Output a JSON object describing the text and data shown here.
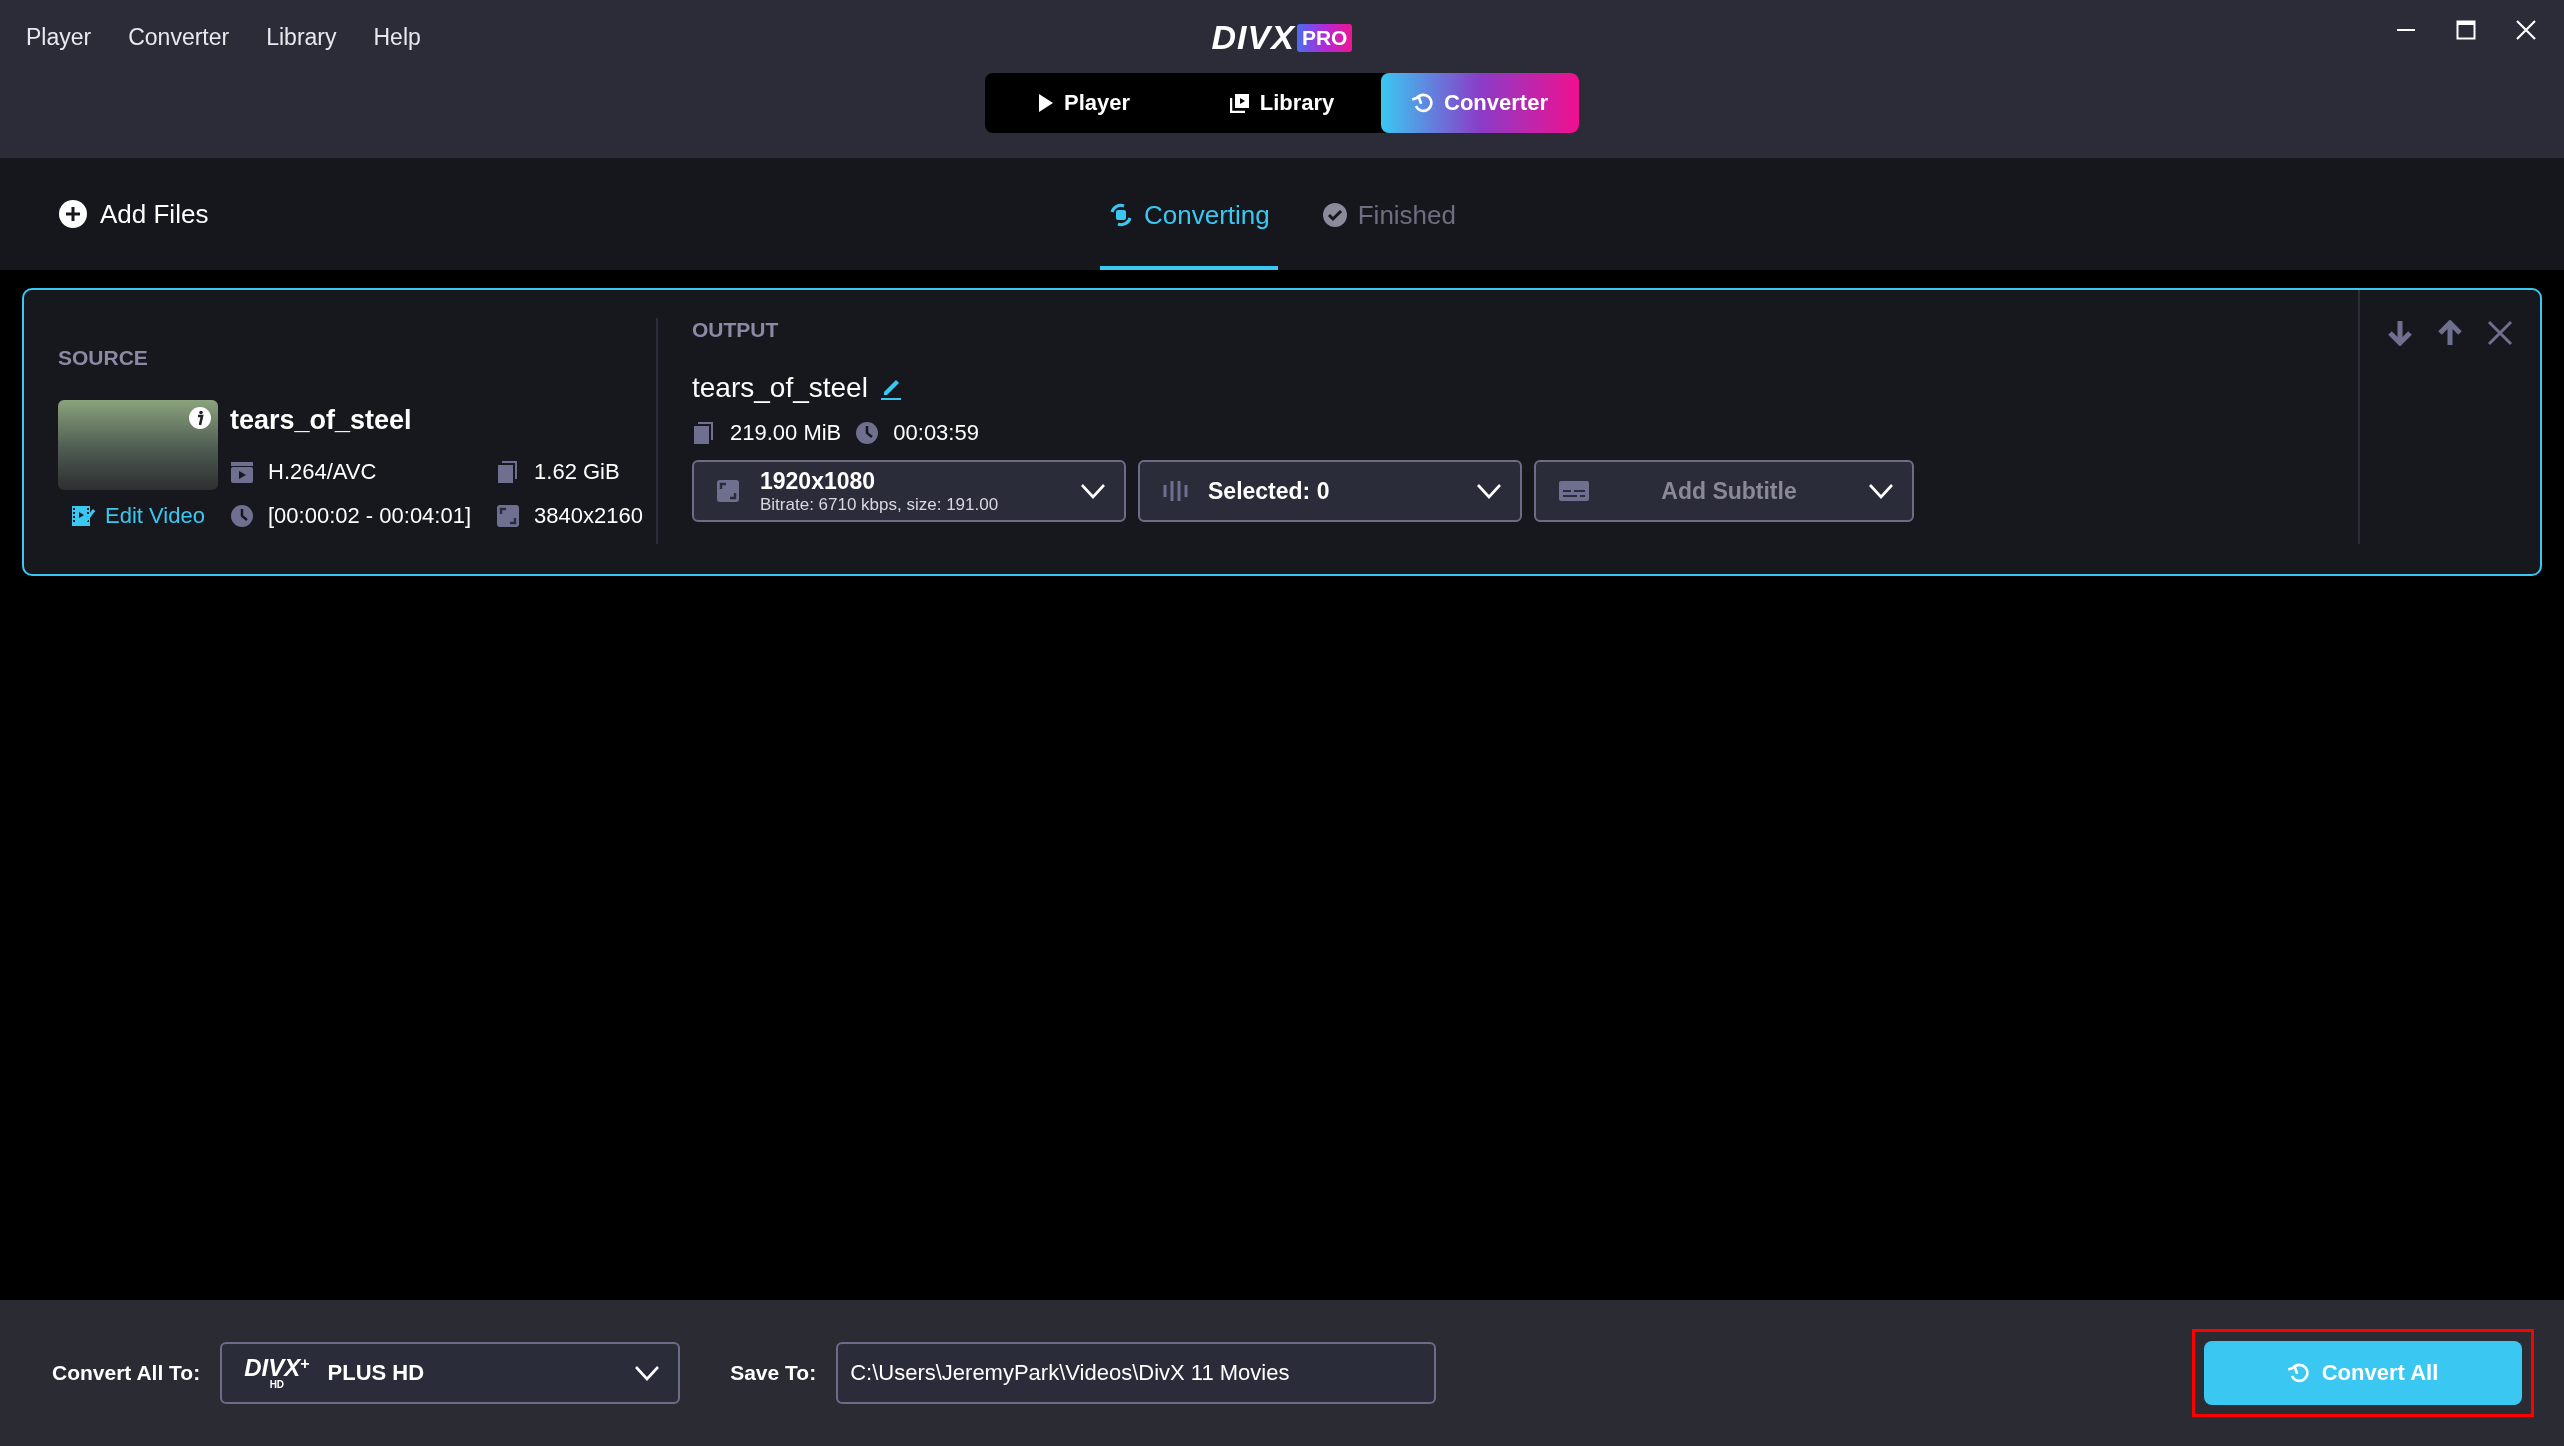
{
  "menu": [
    "Player",
    "Converter",
    "Library",
    "Help"
  ],
  "logo": {
    "text": "DIVX",
    "badge": "PRO"
  },
  "mode_tabs": [
    {
      "label": "Player",
      "kind": "player",
      "selected": false
    },
    {
      "label": "Library",
      "kind": "library",
      "selected": false
    },
    {
      "label": "Converter",
      "kind": "converter",
      "selected": true
    }
  ],
  "toolbar": {
    "add_files": "Add Files"
  },
  "view_tabs": [
    {
      "label": "Converting",
      "kind": "converting",
      "selected": true
    },
    {
      "label": "Finished",
      "kind": "finished",
      "selected": false
    }
  ],
  "jobs": [
    {
      "selected": true,
      "source": {
        "heading": "SOURCE",
        "title": "tears_of_steel",
        "codec": "H.264/AVC",
        "size": "1.62 GiB",
        "edit": "Edit Video",
        "range": "[00:00:02 - 00:04:01]",
        "resolution": "3840x2160"
      },
      "output": {
        "heading": "OUTPUT",
        "title": "tears_of_steel",
        "size": "219.00 MiB",
        "duration": "00:03:59",
        "dropdowns": [
          {
            "kind": "video",
            "title": "1920x1080",
            "detail": "Bitrate: 6710 kbps, size: 191.00"
          },
          {
            "kind": "audio",
            "title": "Selected: 0"
          },
          {
            "kind": "subtitle",
            "title": "Add Subtitle"
          }
        ]
      }
    }
  ],
  "bottom_bar": {
    "convert_label": "Convert All To:",
    "format": {
      "logo": "DIVX",
      "logo_mark": "+",
      "logo_sub": "HD",
      "name": "PLUS HD"
    },
    "save_label": "Save To:",
    "save_path": "C:\\Users\\JeremyPark\\Videos\\DivX 11 Movies",
    "convert_button": "Convert All",
    "highlighted": true
  }
}
